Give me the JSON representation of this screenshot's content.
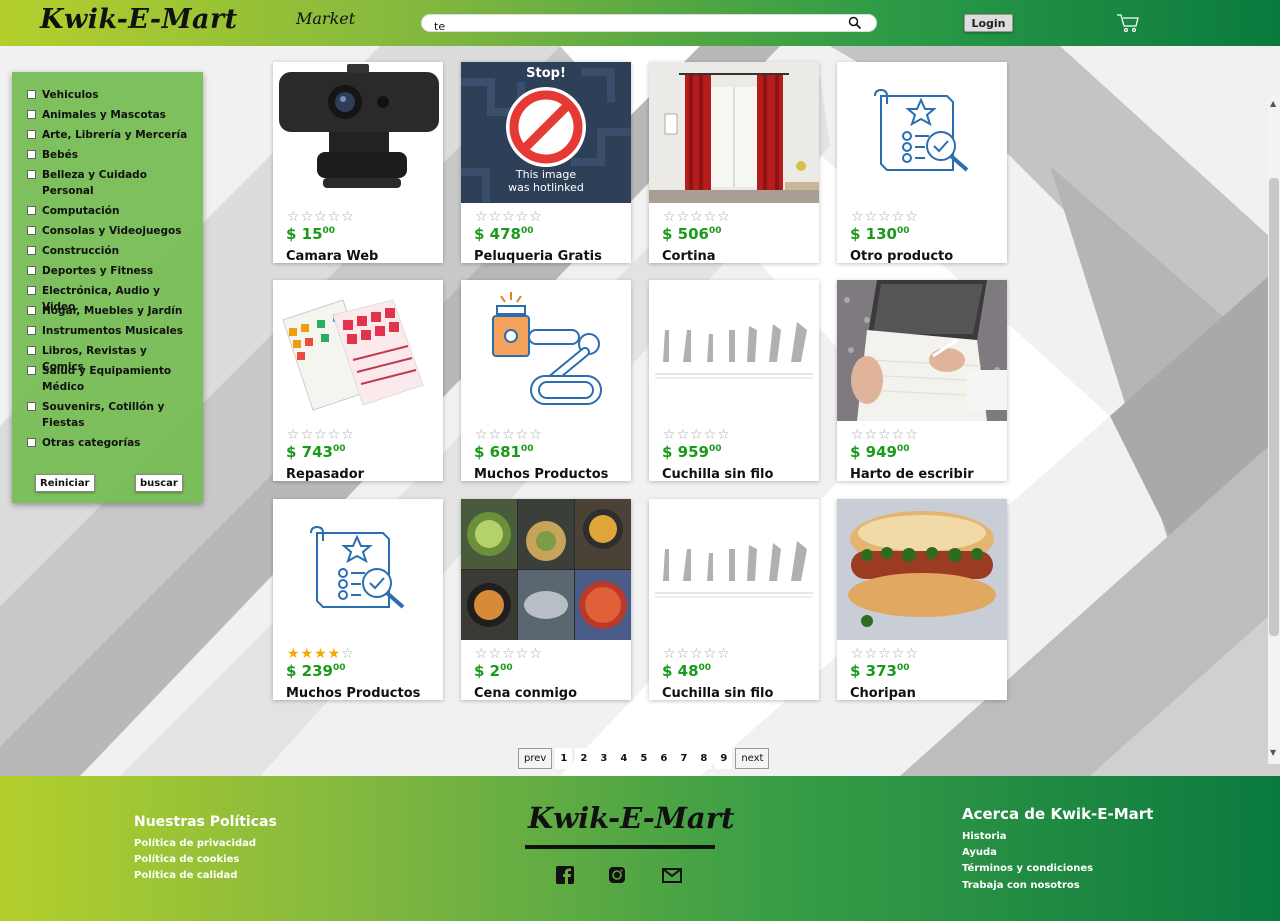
{
  "header": {
    "brand": "Kwik-E-Mart",
    "nav_market": "Market",
    "search_value": "te",
    "login_label": "Login"
  },
  "sidebar": {
    "categories": [
      "Vehiculos",
      "Animales y Mascotas",
      "Arte, Librería y Mercería",
      "Bebés",
      "Belleza y Cuidado Personal",
      "Computación",
      "Consolas y Videojuegos",
      "Construcción",
      "Deportes y Fitness",
      "Electrónica, Audio y Video",
      "Hogar, Muebles y Jardín",
      "Instrumentos Musicales",
      "Libros, Revistas y Comics",
      "Salud y Equipamiento Médico",
      "Souvenirs, Cotillón y Fiestas",
      "Otras categorías"
    ],
    "reset_label": "Reiniciar",
    "search_label": "buscar"
  },
  "products": [
    {
      "name": "Camara Web",
      "price": "$ 15",
      "cents": "00",
      "rating": 0
    },
    {
      "name": "Peluqueria Gratis",
      "price": "$ 478",
      "cents": "00",
      "rating": 0,
      "image_text_1": "Stop!",
      "image_text_2": "This image",
      "image_text_3": "was hotlinked"
    },
    {
      "name": "Cortina",
      "price": "$ 506",
      "cents": "00",
      "rating": 0
    },
    {
      "name": "Otro producto",
      "price": "$ 130",
      "cents": "00",
      "rating": 0
    },
    {
      "name": "Repasador",
      "price": "$ 743",
      "cents": "00",
      "rating": 0
    },
    {
      "name": "Muchos Productos",
      "price": "$ 681",
      "cents": "00",
      "rating": 0
    },
    {
      "name": "Cuchilla sin filo",
      "price": "$ 959",
      "cents": "00",
      "rating": 0
    },
    {
      "name": "Harto de escribir",
      "price": "$ 949",
      "cents": "00",
      "rating": 0
    },
    {
      "name": "Muchos Productos",
      "price": "$ 239",
      "cents": "00",
      "rating": 4
    },
    {
      "name": "Cena conmigo",
      "price": "$ 2",
      "cents": "00",
      "rating": 0
    },
    {
      "name": "Cuchilla sin filo",
      "price": "$ 48",
      "cents": "00",
      "rating": 0
    },
    {
      "name": "Choripan",
      "price": "$ 373",
      "cents": "00",
      "rating": 0
    }
  ],
  "pagination": {
    "prev": "prev",
    "pages": [
      "1",
      "2",
      "3",
      "4",
      "5",
      "6",
      "7",
      "8",
      "9"
    ],
    "next": "next"
  },
  "footer": {
    "policies_title": "Nuestras Políticas",
    "policies": [
      "Política de privacidad",
      "Política de cookies",
      "Política de calidad"
    ],
    "brand": "Kwik-E-Mart",
    "about_title": "Acerca de Kwik-E-Mart",
    "about_links": [
      "Historia",
      "Ayuda",
      "Términos y condiciones",
      "Trabaja con nosotros"
    ]
  },
  "colors": {
    "header_left": "#b3cf2c",
    "header_right": "#0a7a3e",
    "price_green": "#1a9a1a",
    "star_gold": "#f5a800",
    "sidebar_green": "#74bc50"
  },
  "icons": [
    "search-icon",
    "cart-icon",
    "facebook-icon",
    "instagram-icon",
    "mail-icon"
  ]
}
